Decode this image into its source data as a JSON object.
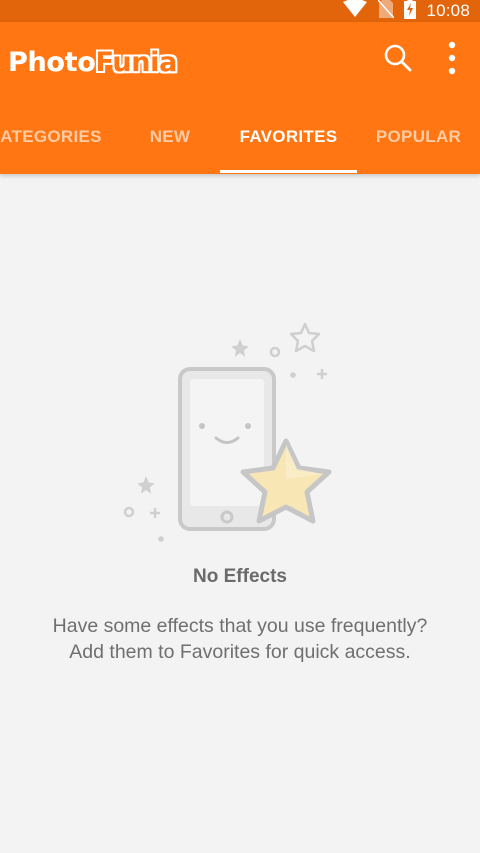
{
  "status_bar": {
    "time": "10:08",
    "icons": [
      "wifi-icon",
      "no-sim-icon",
      "battery-charging-icon"
    ]
  },
  "app_bar": {
    "logo": {
      "part1": "Photo",
      "part2": "Funia"
    },
    "actions": [
      "search-icon",
      "more-vert-icon"
    ],
    "color": "#ff7612",
    "status_color": "#e2650b"
  },
  "tabs": [
    {
      "label": "ATEGORIES",
      "active": false
    },
    {
      "label": "NEW",
      "active": false
    },
    {
      "label": "FAVORITES",
      "active": true
    },
    {
      "label": "POPULAR",
      "active": false
    }
  ],
  "empty_state": {
    "illustration": "phone-with-star-icon",
    "title": "No Effects",
    "description": "Have some effects that you use frequently? Add them to Favorites for quick access."
  }
}
